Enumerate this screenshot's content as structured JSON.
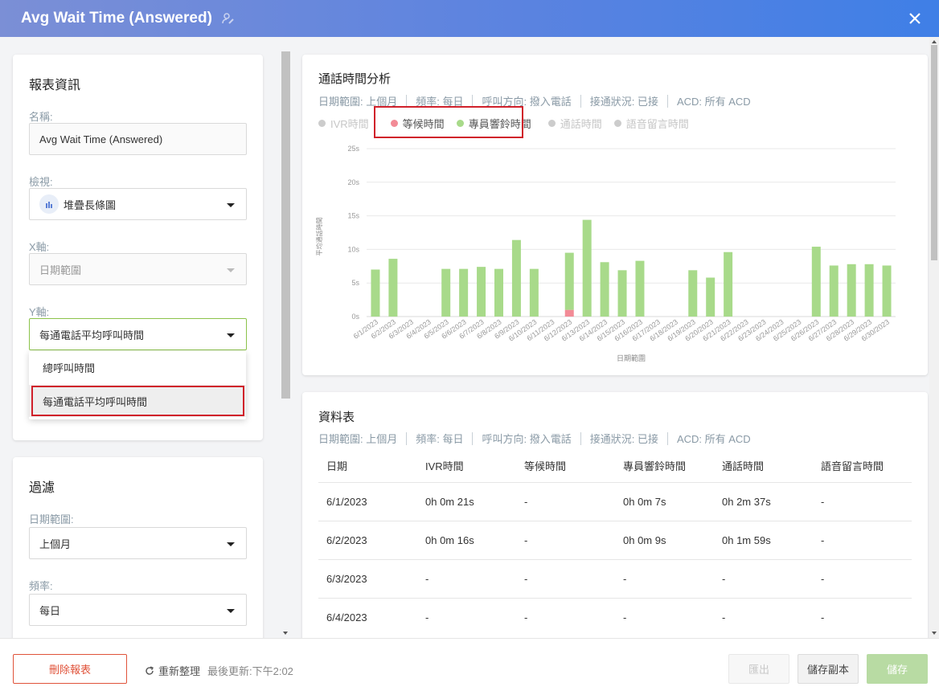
{
  "header": {
    "title": "Avg Wait Time (Answered)"
  },
  "report_info": {
    "section_title": "報表資訊",
    "name_label": "名稱:",
    "name_value": "Avg Wait Time (Answered)",
    "view_label": "檢視:",
    "view_value": "堆疊長條圖",
    "x_axis_label": "X軸:",
    "x_axis_value": "日期範圍",
    "y_axis_label": "Y軸:",
    "y_axis_value": "每通電話平均呼叫時間",
    "y_axis_options": [
      "總呼叫時間",
      "每通電話平均呼叫時間"
    ]
  },
  "filter": {
    "section_title": "過濾",
    "date_range_label": "日期範圍:",
    "date_range_value": "上個月",
    "frequency_label": "頻率:",
    "frequency_value": "每日"
  },
  "chart_card": {
    "title": "通話時間分析",
    "meta": [
      "日期範圍: 上個月",
      "頻率: 每日",
      "呼叫方向: 撥入電話",
      "接通狀況: 已接",
      "ACD: 所有 ACD"
    ]
  },
  "chart_data": {
    "type": "bar",
    "stacked": true,
    "ylabel": "平均通話時間",
    "xlabel": "日期範圍",
    "ylim": [
      0,
      25
    ],
    "yticks": [
      "0s",
      "5s",
      "10s",
      "15s",
      "20s",
      "25s"
    ],
    "categories": [
      "6/1/2023",
      "6/2/2023",
      "6/3/2023",
      "6/4/2023",
      "6/5/2023",
      "6/6/2023",
      "6/7/2023",
      "6/8/2023",
      "6/9/2023",
      "6/10/2023",
      "6/11/2023",
      "6/12/2023",
      "6/13/2023",
      "6/14/2023",
      "6/15/2023",
      "6/16/2023",
      "6/17/2023",
      "6/18/2023",
      "6/19/2023",
      "6/20/2023",
      "6/21/2023",
      "6/22/2023",
      "6/23/2023",
      "6/24/2023",
      "6/25/2023",
      "6/26/2023",
      "6/27/2023",
      "6/28/2023",
      "6/29/2023",
      "6/30/2023"
    ],
    "legend": [
      {
        "name": "IVR時間",
        "color": "#cccccc",
        "active": false
      },
      {
        "name": "等候時間",
        "color": "#f28b96",
        "active": true
      },
      {
        "name": "專員響鈴時間",
        "color": "#a8da8a",
        "active": true
      },
      {
        "name": "通話時間",
        "color": "#cccccc",
        "active": false
      },
      {
        "name": "語音留言時間",
        "color": "#cccccc",
        "active": false
      }
    ],
    "series": [
      {
        "name": "等候時間",
        "color": "#f28b96",
        "values": [
          0,
          0,
          0,
          0,
          0,
          0,
          0,
          0,
          0,
          0,
          0,
          1,
          0,
          0,
          0,
          0,
          0,
          0,
          0,
          0,
          0,
          0,
          0,
          0,
          0,
          0,
          0,
          0,
          0,
          0
        ]
      },
      {
        "name": "專員響鈴時間",
        "color": "#a8da8a",
        "values": [
          7,
          8.6,
          0,
          0,
          7.1,
          7.1,
          7.4,
          7.1,
          11.4,
          7.1,
          0,
          8.5,
          14.4,
          8.1,
          6.9,
          8.3,
          0,
          0,
          6.9,
          5.8,
          9.6,
          0,
          0,
          0,
          0,
          10.4,
          7.6,
          7.8,
          7.8,
          7.6
        ]
      }
    ]
  },
  "data_table": {
    "title": "資料表",
    "meta": [
      "日期範圍: 上個月",
      "頻率: 每日",
      "呼叫方向: 撥入電話",
      "接通狀況: 已接",
      "ACD: 所有 ACD"
    ],
    "columns": [
      "日期",
      "IVR時間",
      "等候時間",
      "專員響鈴時間",
      "通話時間",
      "語音留言時間"
    ],
    "rows": [
      [
        "6/1/2023",
        "0h 0m 21s",
        "-",
        "0h 0m 7s",
        "0h 2m 37s",
        "-"
      ],
      [
        "6/2/2023",
        "0h 0m 16s",
        "-",
        "0h 0m 9s",
        "0h 1m 59s",
        "-"
      ],
      [
        "6/3/2023",
        "-",
        "-",
        "-",
        "-",
        "-"
      ],
      [
        "6/4/2023",
        "-",
        "-",
        "-",
        "-",
        "-"
      ]
    ]
  },
  "footer": {
    "delete_label": "刪除報表",
    "refresh_label": "重新整理",
    "last_update": "最後更新:下午2:02",
    "export_label": "匯出",
    "save_copy_label": "儲存副本",
    "save_label": "儲存"
  },
  "colors": {
    "accent_green": "#8bc34a",
    "highlight_red": "#d0202a",
    "header_start": "#7b8fd6",
    "header_end": "#3f7fe6"
  }
}
